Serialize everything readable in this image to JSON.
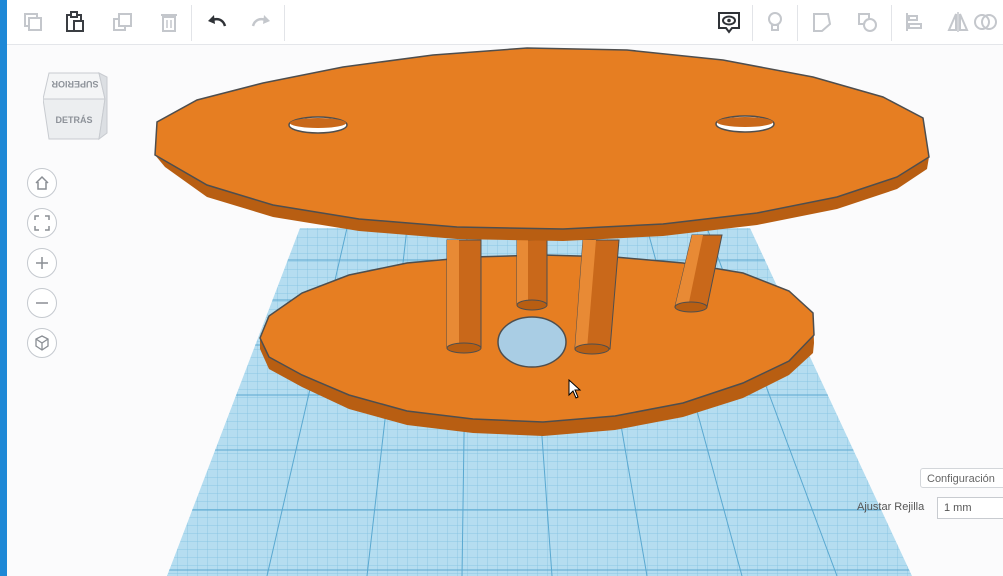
{
  "toolbar": {
    "buttons": [
      {
        "icon": "copy-icon"
      },
      {
        "icon": "paste-icon"
      },
      {
        "icon": "duplicate-icon"
      },
      {
        "icon": "trash-icon"
      },
      {
        "icon": "undo-icon"
      },
      {
        "icon": "redo-icon"
      },
      {
        "icon": "show-all-eye-icon"
      },
      {
        "icon": "lightbulb-icon"
      },
      {
        "icon": "note-icon"
      },
      {
        "icon": "ruler-shape-icon"
      },
      {
        "icon": "align-icon"
      },
      {
        "icon": "mirror-icon"
      },
      {
        "icon": "group-icon"
      }
    ]
  },
  "viewcube": {
    "top_label": "SUPERIOR",
    "back_label": "DETRÁS"
  },
  "nav": [
    {
      "icon": "home-icon"
    },
    {
      "icon": "fit-view-icon"
    },
    {
      "icon": "zoom-in-icon"
    },
    {
      "icon": "zoom-out-icon"
    },
    {
      "icon": "perspective-cube-icon"
    }
  ],
  "settings": {
    "label": "Configuración"
  },
  "grid": {
    "label": "Ajustar Rejilla",
    "value": "1 mm"
  },
  "colors": {
    "accent": "#1e88d6",
    "shape_orange": "#e67e22",
    "grid_blue": "#a9d8ee"
  }
}
